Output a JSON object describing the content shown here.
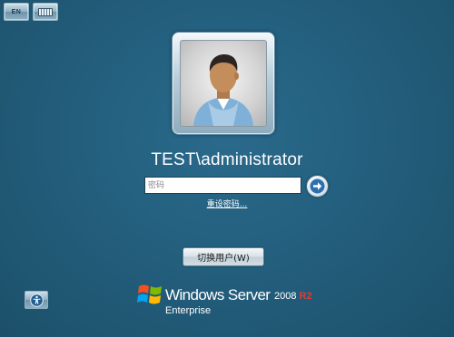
{
  "top_bar": {
    "language_label": "EN",
    "keyboard_icon": "keyboard-icon"
  },
  "user": {
    "avatar_icon": "user-avatar-icon",
    "name": "TEST\\administrator"
  },
  "password": {
    "placeholder": "密码",
    "value": ""
  },
  "submit": {
    "icon": "arrow-right-icon"
  },
  "reset_password": {
    "label": "重设密码..."
  },
  "switch_user": {
    "label": "切换用户(W)"
  },
  "ease_of_access": {
    "icon": "ease-of-access-icon"
  },
  "branding": {
    "windows": "Windows",
    "server": "Server",
    "version": "2008",
    "release": "R2",
    "edition": "Enterprise"
  },
  "colors": {
    "background": "#225c7a",
    "text": "#ffffff",
    "release_accent": "#e43a2e"
  }
}
